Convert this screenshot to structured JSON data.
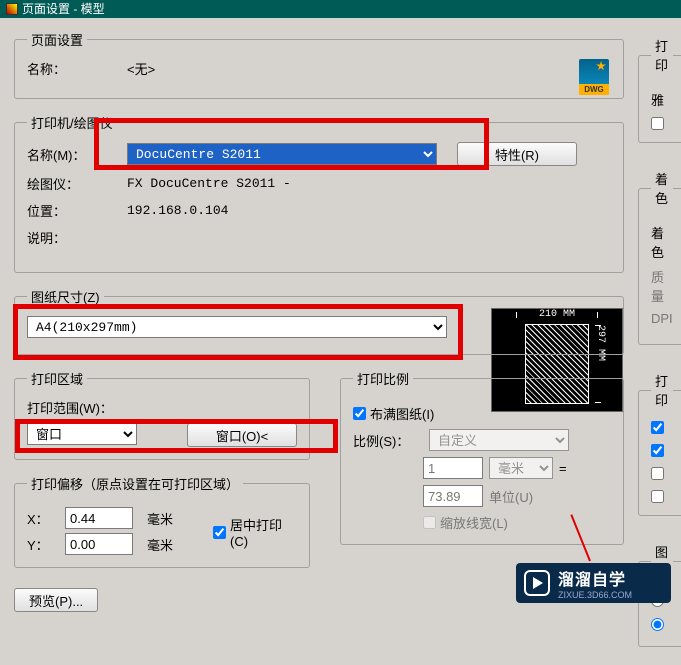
{
  "window": {
    "title": "页面设置 - 模型"
  },
  "page_setup": {
    "legend": "页面设置",
    "name_label": "名称：",
    "name_value": "<无>"
  },
  "printer": {
    "legend": "打印机/绘图仪",
    "name_label": "名称(M)：",
    "name_value": "DocuCentre S2011",
    "props_btn": "特性(R)",
    "plotter_label": "绘图仪：",
    "plotter_value": "FX DocuCentre S2011 -",
    "location_label": "位置：",
    "location_value": "192.168.0.104",
    "desc_label": "说明：",
    "preview_w": "210 MM",
    "preview_h": "297 MM"
  },
  "paper": {
    "legend": "图纸尺寸(Z)",
    "value": "A4(210x297mm)"
  },
  "area": {
    "legend": "打印区域",
    "range_label": "打印范围(W)：",
    "range_value": "窗口",
    "window_btn": "窗口(O)<"
  },
  "offset": {
    "legend": "打印偏移（原点设置在可打印区域）",
    "x_label": "X：",
    "x_value": "0.44",
    "y_label": "Y：",
    "y_value": "0.00",
    "unit": "毫米",
    "center": "居中打印(C)"
  },
  "scale": {
    "legend": "打印比例",
    "fit": "布满图纸(I)",
    "ratio_label": "比例(S)：",
    "ratio_value": "自定义",
    "num": "1",
    "num_unit": "毫米",
    "eq": "=",
    "den": "73.89",
    "den_unit": "单位(U)",
    "lw": "缩放线宽(L)"
  },
  "right": {
    "print_legend": "打印",
    "ya": "雅",
    "style_legend": "着色",
    "style_label": "着色",
    "quality_label": "质量",
    "dpi_label": "DPI",
    "opts_legend": "打印",
    "shape_legend": "图形"
  },
  "preview_btn": "预览(P)...",
  "watermark": {
    "name": "溜溜自学",
    "sub": "ZIXUE.3D66.COM"
  }
}
